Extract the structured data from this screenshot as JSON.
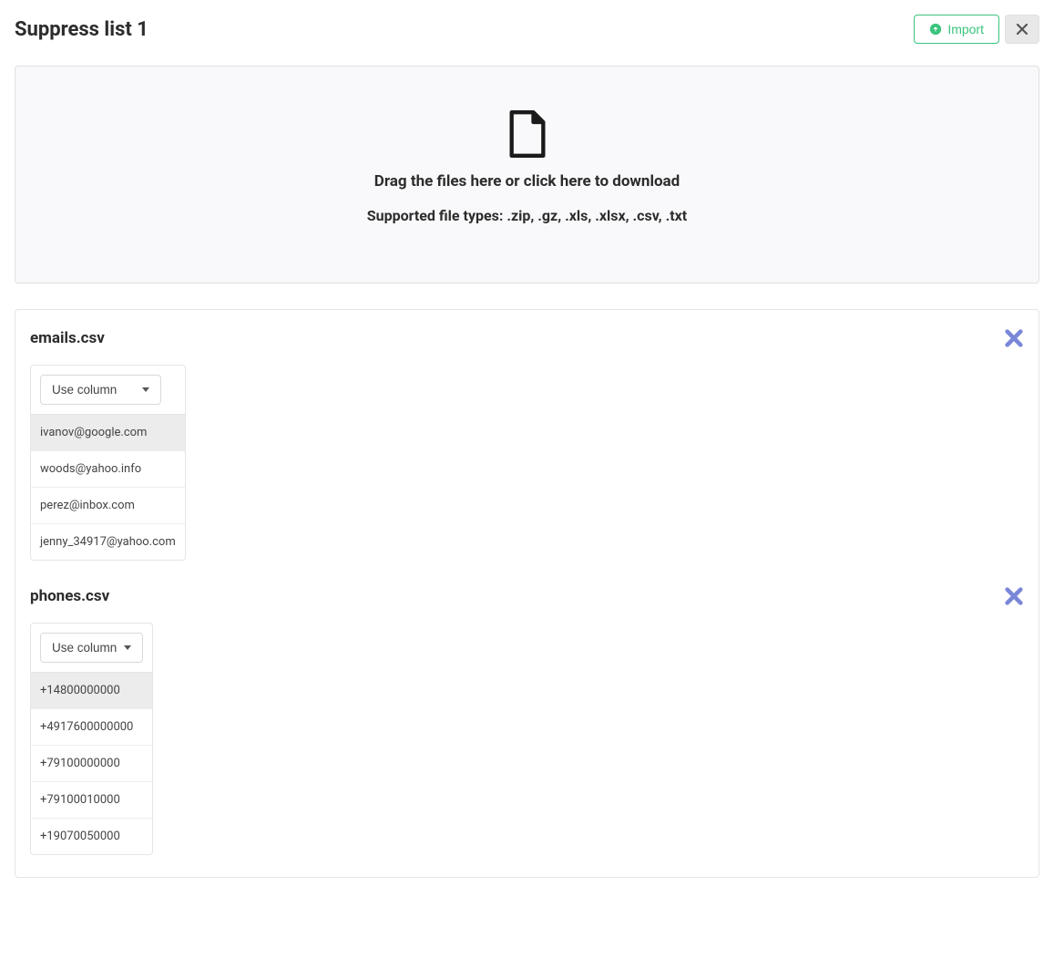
{
  "header": {
    "title": "Suppress list 1",
    "import_label": "Import"
  },
  "dropzone": {
    "main_text": "Drag the files here or click here to download",
    "sub_text": "Supported file types: .zip, .gz, .xls, .xlsx, .csv, .txt"
  },
  "files": [
    {
      "name": "emails.csv",
      "use_column_label": "Use column",
      "rows": [
        "ivanov@google.com",
        "woods@yahoo.info",
        "perez@inbox.com",
        "jenny_34917@yahoo.com"
      ]
    },
    {
      "name": "phones.csv",
      "use_column_label": "Use column",
      "rows": [
        "+14800000000",
        "+4917600000000",
        "+79100000000",
        "+79100010000",
        "+19070050000"
      ]
    }
  ]
}
